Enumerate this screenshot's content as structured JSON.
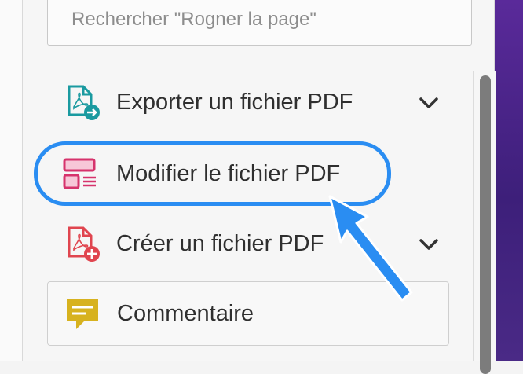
{
  "search": {
    "placeholder": "Rechercher \"Rogner la page\""
  },
  "tools": [
    {
      "label": "Exporter un fichier PDF",
      "icon": "export-pdf-icon",
      "has_chevron": true,
      "color": "#1a9aa0"
    },
    {
      "label": "Modifier le fichier PDF",
      "icon": "edit-pdf-icon",
      "has_chevron": false,
      "color": "#d6336c"
    },
    {
      "label": "Créer un fichier PDF",
      "icon": "create-pdf-icon",
      "has_chevron": true,
      "color": "#e0454f"
    }
  ],
  "comment": {
    "label": "Commentaire",
    "icon": "comment-icon",
    "color": "#d7b21f"
  },
  "annotation": {
    "color": "#2a8df2"
  }
}
